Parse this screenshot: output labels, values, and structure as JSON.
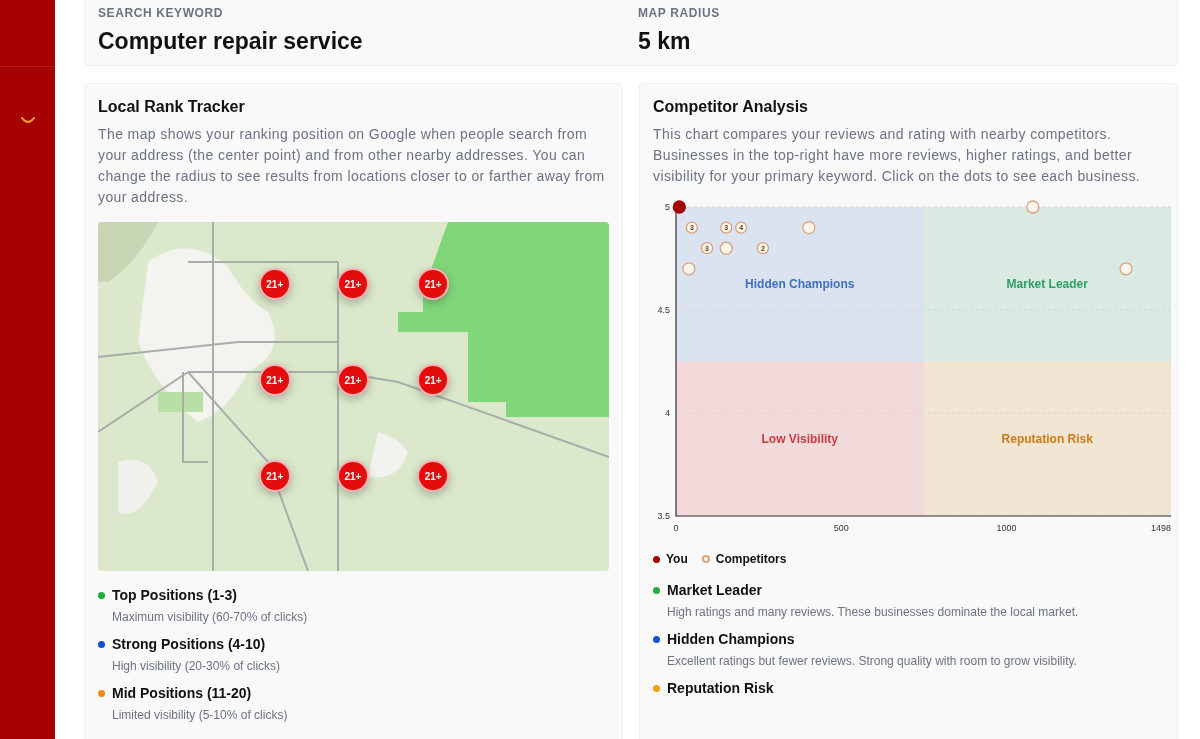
{
  "summary": {
    "fields": [
      {
        "label": "SEARCH KEYWORD",
        "value": "Computer repair service"
      },
      {
        "label": "MAP RADIUS",
        "value": "5 km"
      }
    ]
  },
  "rank_tracker": {
    "title": "Local Rank Tracker",
    "description": "The map shows your ranking position on Google when people search from your address (the center point) and from other nearby addresses. You can change the radius to see results from locations closer to or farther away from your address.",
    "map": {
      "kind": "picture",
      "markers": [
        {
          "label": "21+"
        },
        {
          "label": "21+"
        },
        {
          "label": "21+"
        },
        {
          "label": "21+"
        },
        {
          "label": "21+"
        },
        {
          "label": "21+"
        },
        {
          "label": "21+"
        },
        {
          "label": "21+"
        },
        {
          "label": "21+"
        }
      ]
    },
    "legend": [
      {
        "title": "Top Positions (1-3)",
        "description": "Maximum visibility (60-70% of clicks)",
        "color": "#1fae3c"
      },
      {
        "title": "Strong Positions (4-10)",
        "description": "High visibility (20-30% of clicks)",
        "color": "#1553d6"
      },
      {
        "title": "Mid Positions (11-20)",
        "description": "Limited visibility (5-10% of clicks)",
        "color": "#f08a12"
      }
    ]
  },
  "competitor_analysis": {
    "title": "Competitor Analysis",
    "description": "This chart compares your reviews and rating with nearby competitors. Businesses in the top-right have more reviews, higher ratings, and better visibility for your primary keyword. Click on the dots to see each business.",
    "chart_data": {
      "type": "scatter",
      "xlim": [
        0,
        1498
      ],
      "ylim": [
        3.5,
        5
      ],
      "xticks": [
        0,
        500,
        1000,
        1498
      ],
      "yticks": [
        3.5,
        4,
        4.5,
        5
      ],
      "series": [
        {
          "name": "You",
          "color": "#a30000",
          "x": [
            10
          ],
          "values": [
            5
          ]
        },
        {
          "name": "Competitors",
          "color": "#d9a27a",
          "x": [
            48,
            152,
            197,
            402,
            94,
            152,
            263,
            39,
            1080,
            1362
          ],
          "values": [
            4.9,
            4.9,
            4.9,
            4.9,
            4.8,
            4.8,
            4.8,
            4.7,
            5,
            4.7
          ]
        }
      ],
      "annotations": [
        {
          "text": "3",
          "x": 48,
          "y": 4.9
        },
        {
          "text": "3",
          "x": 152,
          "y": 4.9
        },
        {
          "text": "4",
          "x": 197,
          "y": 4.9
        },
        {
          "text": "3",
          "x": 94,
          "y": 4.8
        },
        {
          "text": "2",
          "x": 263,
          "y": 4.8
        }
      ]
    },
    "quadrants": [
      {
        "label": "Hidden Champions",
        "color": "#3c6fc4"
      },
      {
        "label": "Market Leader",
        "color": "#2e9e63"
      },
      {
        "label": "Low Visibility",
        "color": "#d0383f"
      },
      {
        "label": "Reputation Risk",
        "color": "#d27a12"
      }
    ],
    "legend": [
      {
        "title": "Market Leader",
        "description": "High ratings and many reviews. These businesses dominate the local market.",
        "color": "#1fae3c"
      },
      {
        "title": "Hidden Champions",
        "description": "Excellent ratings but fewer reviews. Strong quality with room to grow visibility.",
        "color": "#1553d6"
      },
      {
        "title": "Reputation Risk",
        "color": "#f0a012"
      }
    ]
  }
}
